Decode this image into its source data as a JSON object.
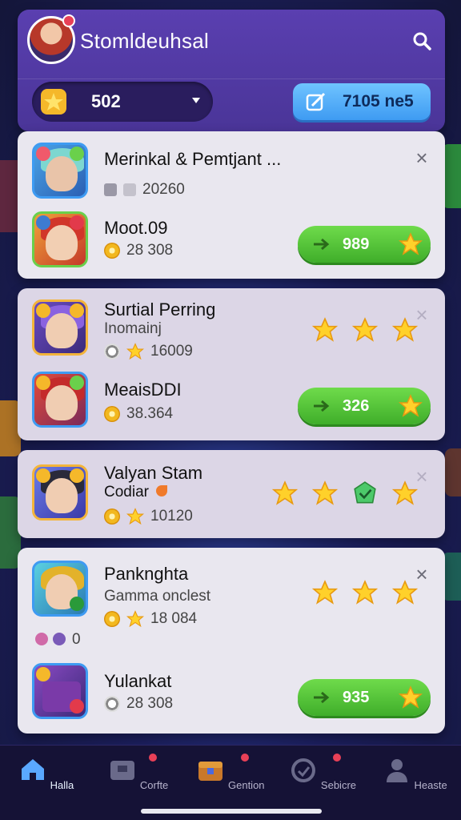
{
  "header": {
    "title": "Stomldeuhsal",
    "coins": "502",
    "gems": "7105 ne5"
  },
  "cards": [
    {
      "rows": [
        {
          "title": "Merinkal & Pemtjant ...",
          "meta": "20260",
          "close": "×"
        },
        {
          "title": "Moot.09",
          "meta": "28 308",
          "play_value": "989"
        }
      ]
    },
    {
      "rows": [
        {
          "title": "Surtial Perring",
          "subtitle": "Inomainj",
          "meta": "16009",
          "close": "×"
        },
        {
          "title": "MeaisDDI",
          "meta": "38.364",
          "play_value": "326"
        }
      ]
    },
    {
      "rows": [
        {
          "title": "Valyan Stam",
          "subtitle": "Codiar",
          "meta": "10120",
          "close": "×"
        }
      ]
    },
    {
      "rows": [
        {
          "title": "Panknghta",
          "subtitle": "Gamma onclest",
          "meta": "18 084",
          "close": "×",
          "count": "0"
        },
        {
          "title": "Yulankat",
          "meta": "28 308",
          "play_value": "935"
        }
      ]
    }
  ],
  "nav": [
    {
      "label": "Halla",
      "icon": "home-icon"
    },
    {
      "label": "Corfte",
      "icon": "inbox-icon"
    },
    {
      "label": "Gention",
      "icon": "chest-icon"
    },
    {
      "label": "Sebicre",
      "icon": "settings-icon"
    },
    {
      "label": "Heaste",
      "icon": "profile-icon"
    }
  ],
  "colors": {
    "accent": "#5a3fb0",
    "play": "#4cc233",
    "gem": "#3e9bf2"
  }
}
